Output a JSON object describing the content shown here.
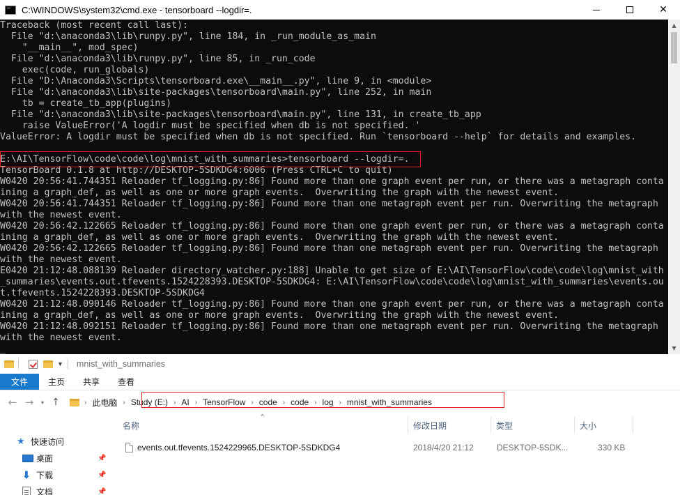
{
  "cmd": {
    "title": "C:\\WINDOWS\\system32\\cmd.exe - tensorboard  --logdir=.",
    "lines": [
      "Traceback (most recent call last):",
      "  File \"d:\\anaconda3\\lib\\runpy.py\", line 184, in _run_module_as_main",
      "    \"__main__\", mod_spec)",
      "  File \"d:\\anaconda3\\lib\\runpy.py\", line 85, in _run_code",
      "    exec(code, run_globals)",
      "  File \"D:\\Anaconda3\\Scripts\\tensorboard.exe\\__main__.py\", line 9, in <module>",
      "  File \"d:\\anaconda3\\lib\\site-packages\\tensorboard\\main.py\", line 252, in main",
      "    tb = create_tb_app(plugins)",
      "  File \"d:\\anaconda3\\lib\\site-packages\\tensorboard\\main.py\", line 131, in create_tb_app",
      "    raise ValueError('A logdir must be specified when db is not specified. '",
      "ValueError: A logdir must be specified when db is not specified. Run `tensorboard --help` for details and examples.",
      "",
      "E:\\AI\\TensorFlow\\code\\code\\log\\mnist_with_summaries>tensorboard --logdir=.",
      "TensorBoard 0.1.8 at http://DESKTOP-5SDKDG4:6006 (Press CTRL+C to quit)",
      "W0420 20:56:41.744351 Reloader tf_logging.py:86] Found more than one graph event per run, or there was a metagraph conta",
      "ining a graph_def, as well as one or more graph events.  Overwriting the graph with the newest event.",
      "W0420 20:56:41.744351 Reloader tf_logging.py:86] Found more than one metagraph event per run. Overwriting the metagraph",
      "with the newest event.",
      "W0420 20:56:42.122665 Reloader tf_logging.py:86] Found more than one graph event per run, or there was a metagraph conta",
      "ining a graph_def, as well as one or more graph events.  Overwriting the graph with the newest event.",
      "W0420 20:56:42.122665 Reloader tf_logging.py:86] Found more than one metagraph event per run. Overwriting the metagraph",
      "with the newest event.",
      "E0420 21:12:48.088139 Reloader directory_watcher.py:188] Unable to get size of E:\\AI\\TensorFlow\\code\\code\\log\\mnist_with",
      "_summaries\\events.out.tfevents.1524228393.DESKTOP-5SDKDG4: E:\\AI\\TensorFlow\\code\\code\\log\\mnist_with_summaries\\events.ou",
      "t.tfevents.1524228393.DESKTOP-5SDKDG4",
      "W0420 21:12:48.090146 Reloader tf_logging.py:86] Found more than one graph event per run, or there was a metagraph conta",
      "ining a graph_def, as well as one or more graph events.  Overwriting the graph with the newest event.",
      "W0420 21:12:48.092151 Reloader tf_logging.py:86] Found more than one metagraph event per run. Overwriting the metagraph",
      "with the newest event.",
      "_"
    ]
  },
  "explorer": {
    "qat_title": "mnist_with_summaries",
    "ribbon_tabs": [
      "文件",
      "主页",
      "共享",
      "查看"
    ],
    "breadcrumbs": [
      "此电脑",
      "Study (E:)",
      "AI",
      "TensorFlow",
      "code",
      "code",
      "log",
      "mnist_with_summaries"
    ],
    "nav": {
      "quick_access": "快速访问",
      "desktop": "桌面",
      "downloads": "下载",
      "documents": "文档"
    },
    "columns": {
      "name": "名称",
      "modified": "修改日期",
      "type": "类型",
      "size": "大小"
    },
    "files": [
      {
        "name": "events.out.tfevents.1524229965.DESKTOP-5SDKDG4",
        "modified": "2018/4/20 21:12",
        "type": "DESKTOP-5SDK...",
        "size": "330 KB"
      }
    ]
  }
}
